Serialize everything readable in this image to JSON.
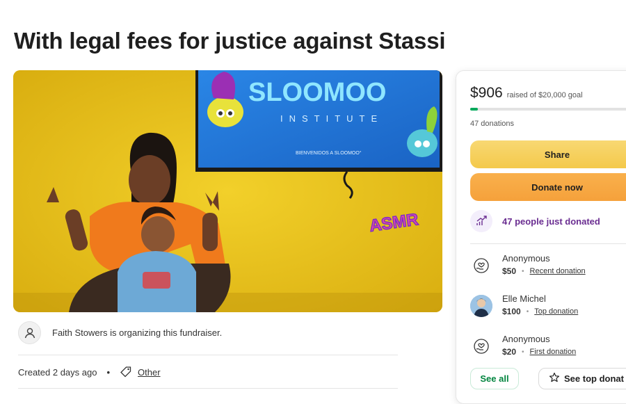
{
  "page": {
    "title": "With legal fees for justice against Stassi"
  },
  "hero": {
    "screen_brand": "SLOOMOO",
    "screen_subtitle": "INSTITUTE",
    "screen_welcome": "BIENVENIDOS A SLOOMOO°",
    "wall_sign": "ASMR",
    "icons": {
      "wall_color": "#e9c31b",
      "screen_color": "#1e78d9"
    }
  },
  "organizer": {
    "text": "Faith Stowers is organizing this fundraiser.",
    "icon": "person-icon"
  },
  "meta": {
    "created": "Created 2 days ago",
    "separator": "•",
    "category": "Other",
    "icon": "tag-icon"
  },
  "donation_card": {
    "raised_amount": "$906",
    "raised_of": "raised of $20,000 goal",
    "progress_fraction": 0.045,
    "donation_count": "47 donations",
    "share_label": "Share",
    "donate_label": "Donate now",
    "trend_text": "47 people just donated",
    "trend_icon": "trending-up-icon",
    "donors": [
      {
        "name": "Anonymous",
        "amount": "$50",
        "separator": "•",
        "badge": "Recent donation",
        "icon": "heart-hand-icon"
      },
      {
        "name": "Elle Michel",
        "amount": "$100",
        "separator": "•",
        "badge": "Top donation",
        "icon": "photo-avatar"
      },
      {
        "name": "Anonymous",
        "amount": "$20",
        "separator": "•",
        "badge": "First donation",
        "icon": "heart-hand-icon"
      }
    ],
    "see_all_label": "See all",
    "see_top_label": "See top donat",
    "colors": {
      "progress": "#02a95c",
      "trend_text": "#6a2d91",
      "see_all": "#02853f"
    }
  }
}
